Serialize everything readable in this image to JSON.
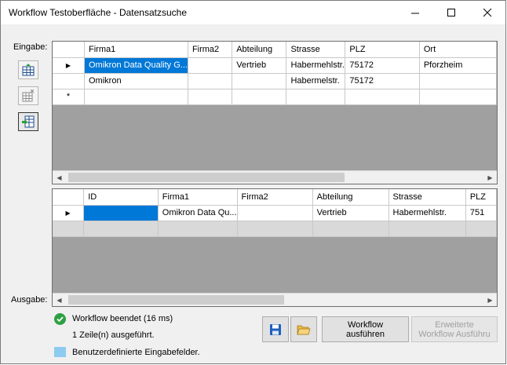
{
  "window": {
    "title": "Workflow Testoberfläche - Datensatzsuche",
    "minimize_icon": "minimize-icon",
    "maximize_icon": "maximize-icon",
    "close_icon": "close-icon"
  },
  "labels": {
    "input": "Eingabe:",
    "output": "Ausgabe:"
  },
  "toolbar_icons": [
    "grid-add-icon",
    "grid-remove-icon",
    "import-icon"
  ],
  "input_grid": {
    "columns": [
      "Firma1",
      "Firma2",
      "Abteilung",
      "Strasse",
      "PLZ",
      "Ort"
    ],
    "rows": [
      [
        "Omikron Data Quality G...",
        "",
        "Vertrieb",
        "Habermehlstr.",
        "75172",
        "Pforzheim"
      ],
      [
        "Omikron",
        "",
        "",
        "Habermelstr.",
        "75172",
        ""
      ]
    ],
    "new_row_marker": "*",
    "current_row_marker": "▶"
  },
  "output_grid": {
    "columns": [
      "ID",
      "Firma1",
      "Firma2",
      "Abteilung",
      "Strasse",
      "PLZ"
    ],
    "rows": [
      [
        "",
        "Omikron Data Qu...",
        "",
        "Vertrieb",
        "Habermehlstr.",
        "751"
      ]
    ],
    "current_row_marker": "▶"
  },
  "status": {
    "message": "Workflow beendet (16 ms)",
    "rows_executed": "1 Zeile(n) ausgeführt.",
    "legend": "Benutzerdefinierte Eingabefelder.",
    "legend_color": "#8ecbf0",
    "ok_color": "#2ea043"
  },
  "buttons": {
    "save_icon": "save-icon",
    "open_icon": "open-folder-icon",
    "run_line1": "Workflow",
    "run_line2": "ausführen",
    "extended_line1": "Erweiterte",
    "extended_line2": "Workflow Ausführu"
  }
}
